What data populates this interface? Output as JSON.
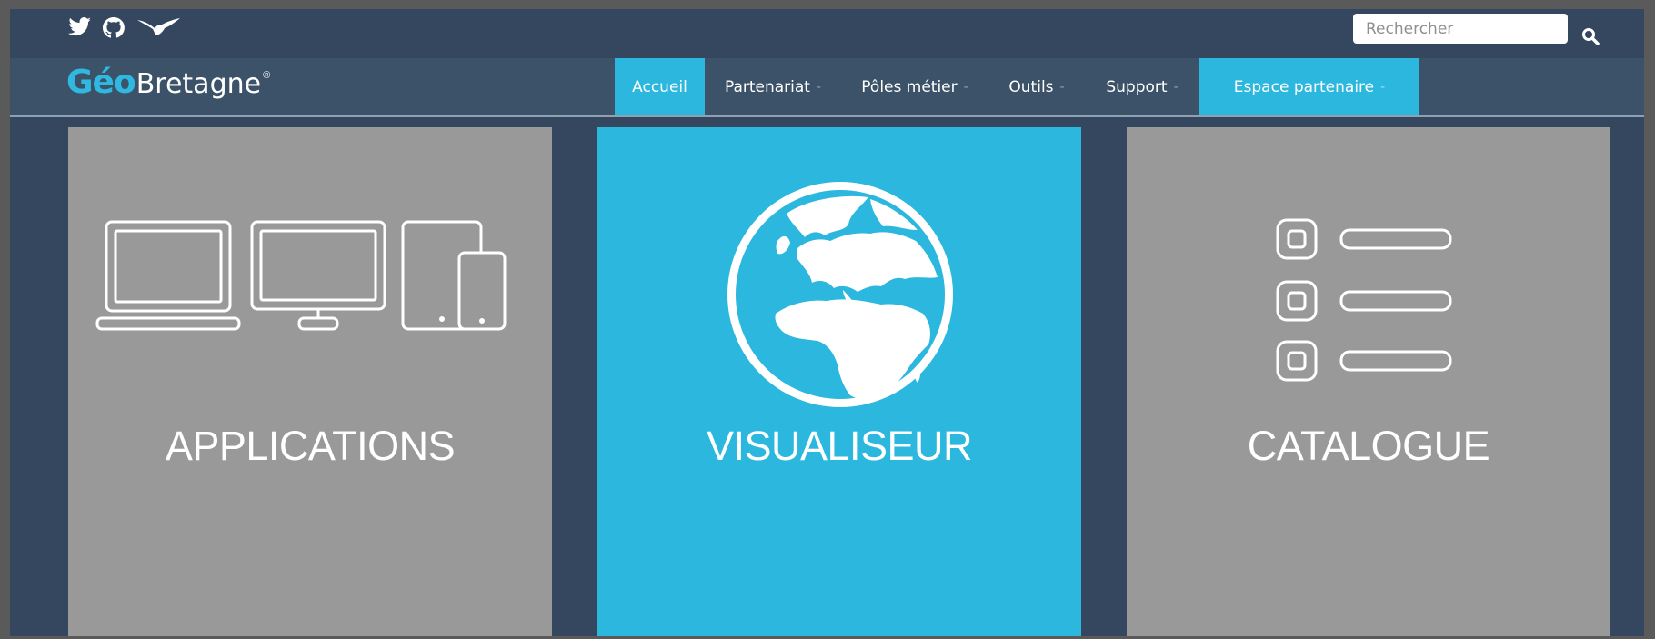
{
  "social": {
    "icons": [
      "twitter-icon",
      "github-icon",
      "bird-icon"
    ]
  },
  "search": {
    "placeholder": "Rechercher",
    "icon": "search-icon"
  },
  "logo": {
    "geo": "Géo",
    "bretagne": "Bretagne",
    "registered": "®"
  },
  "nav": {
    "items": [
      {
        "label": "Accueil",
        "active": true,
        "has_caret": false
      },
      {
        "label": "Partenariat",
        "active": false,
        "has_caret": true
      },
      {
        "label": "Pôles métier",
        "active": false,
        "has_caret": true
      },
      {
        "label": "Outils",
        "active": false,
        "has_caret": true
      },
      {
        "label": "Support",
        "active": false,
        "has_caret": true
      },
      {
        "label": "Espace partenaire",
        "active": true,
        "has_caret": true
      }
    ],
    "caret": "-"
  },
  "tiles": [
    {
      "label": "APPLICATIONS",
      "icon": "devices-icon",
      "color": "#999999"
    },
    {
      "label": "VISUALISEUR",
      "icon": "globe-icon",
      "color": "#2bb7de"
    },
    {
      "label": "CATALOGUE",
      "icon": "list-icon",
      "color": "#999999"
    }
  ],
  "colors": {
    "page_bg": "#34475e",
    "nav_bg": "#3c5268",
    "accent": "#2bb7de",
    "logo_blue": "#2fb9e0",
    "tile_gray": "#999999"
  }
}
